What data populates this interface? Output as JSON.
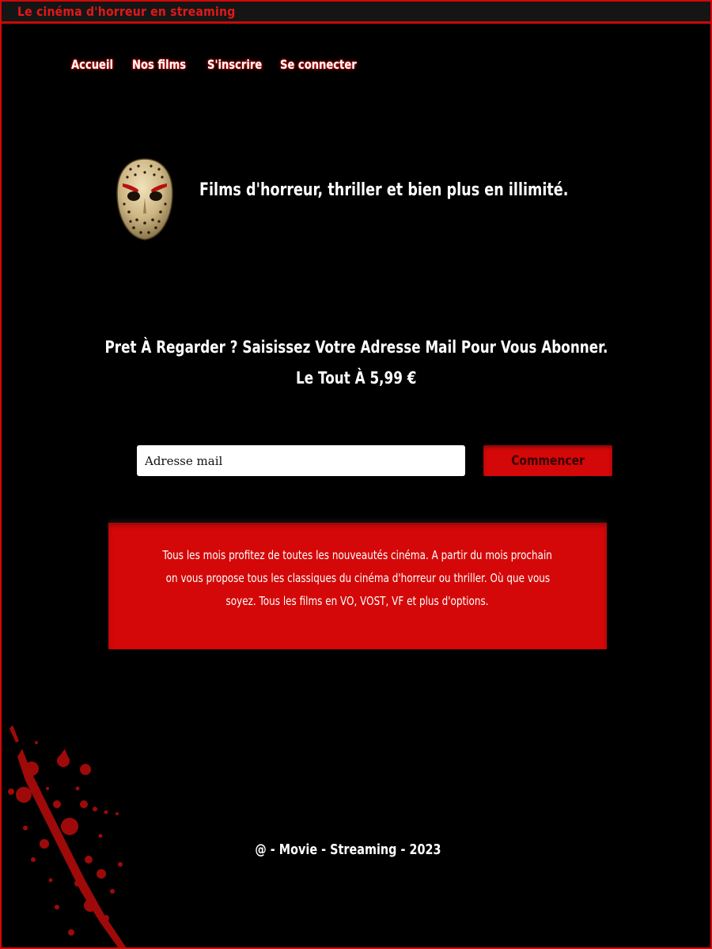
{
  "topbar": {
    "title": "Le cinéma d'horreur en streaming"
  },
  "nav": {
    "items": [
      {
        "label": "Accueil"
      },
      {
        "label": "Nos films"
      },
      {
        "label": "S'inscrire"
      },
      {
        "label": "Se connecter"
      }
    ]
  },
  "hero": {
    "mask_icon": "hockey-mask-icon",
    "title": "Films d'horreur, thriller et bien plus en illimité."
  },
  "cta": {
    "line1": "Pret À Regarder ? Saisissez Votre Adresse Mail Pour Vous Abonner.",
    "line2": "Le Tout À 5,99 €"
  },
  "signup": {
    "email_placeholder": "Adresse mail",
    "button_label": "Commencer"
  },
  "info": {
    "lines": [
      "Tous les mois profitez de toutes les nouveautés cinéma. A partir du mois prochain",
      "on vous propose tous les classiques du cinéma d'horreur ou thriller. Où que vous",
      "soyez. Tous les films en VO, VOST, VF et plus d'options."
    ]
  },
  "decor": {
    "blood_icon": "blood-splatter-icon"
  },
  "footer": {
    "text": "@ - Movie - Streaming - 2023"
  },
  "colors": {
    "accent": "#d40808",
    "background": "#000000",
    "text": "#ffffff"
  }
}
